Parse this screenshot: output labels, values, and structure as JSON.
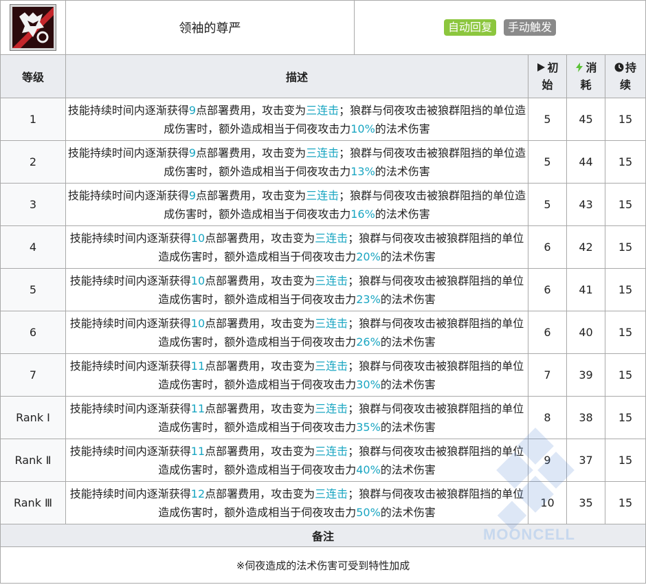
{
  "skill": {
    "name": "领袖的尊严",
    "badges": [
      "自动回复",
      "手动触发"
    ],
    "icon": "wolf-head-skill-icon"
  },
  "columns": {
    "level": "等级",
    "description": "描述",
    "initial_line1": "初",
    "initial_line2": "始",
    "cost_line1": "消",
    "cost_line2": "耗",
    "duration_line1": "持",
    "duration_line2": "续"
  },
  "rows": [
    {
      "level": "1",
      "d1": "技能持续时间内逐渐获得",
      "sp": "9",
      "d2": "点部署费用，攻击变为",
      "hits": "三连击",
      "d3": "；狼群与伺夜攻击被狼群阻挡的单位造成伤害时，额外造成相当于伺夜攻击力",
      "pct": "10%",
      "d4": "的法术伤害",
      "initial": "5",
      "cost": "45",
      "duration": "15"
    },
    {
      "level": "2",
      "d1": "技能持续时间内逐渐获得",
      "sp": "9",
      "d2": "点部署费用，攻击变为",
      "hits": "三连击",
      "d3": "；狼群与伺夜攻击被狼群阻挡的单位造成伤害时，额外造成相当于伺夜攻击力",
      "pct": "13%",
      "d4": "的法术伤害",
      "initial": "5",
      "cost": "44",
      "duration": "15"
    },
    {
      "level": "3",
      "d1": "技能持续时间内逐渐获得",
      "sp": "9",
      "d2": "点部署费用，攻击变为",
      "hits": "三连击",
      "d3": "；狼群与伺夜攻击被狼群阻挡的单位造成伤害时，额外造成相当于伺夜攻击力",
      "pct": "16%",
      "d4": "的法术伤害",
      "initial": "5",
      "cost": "43",
      "duration": "15"
    },
    {
      "level": "4",
      "d1": "技能持续时间内逐渐获得",
      "sp": "10",
      "d2": "点部署费用，攻击变为",
      "hits": "三连击",
      "d3": "；狼群与伺夜攻击被狼群阻挡的单位造成伤害时，额外造成相当于伺夜攻击力",
      "pct": "20%",
      "d4": "的法术伤害",
      "initial": "6",
      "cost": "42",
      "duration": "15"
    },
    {
      "level": "5",
      "d1": "技能持续时间内逐渐获得",
      "sp": "10",
      "d2": "点部署费用，攻击变为",
      "hits": "三连击",
      "d3": "；狼群与伺夜攻击被狼群阻挡的单位造成伤害时，额外造成相当于伺夜攻击力",
      "pct": "23%",
      "d4": "的法术伤害",
      "initial": "6",
      "cost": "41",
      "duration": "15"
    },
    {
      "level": "6",
      "d1": "技能持续时间内逐渐获得",
      "sp": "10",
      "d2": "点部署费用，攻击变为",
      "hits": "三连击",
      "d3": "；狼群与伺夜攻击被狼群阻挡的单位造成伤害时，额外造成相当于伺夜攻击力",
      "pct": "26%",
      "d4": "的法术伤害",
      "initial": "6",
      "cost": "40",
      "duration": "15"
    },
    {
      "level": "7",
      "d1": "技能持续时间内逐渐获得",
      "sp": "11",
      "d2": "点部署费用，攻击变为",
      "hits": "三连击",
      "d3": "；狼群与伺夜攻击被狼群阻挡的单位造成伤害时，额外造成相当于伺夜攻击力",
      "pct": "30%",
      "d4": "的法术伤害",
      "initial": "7",
      "cost": "39",
      "duration": "15"
    },
    {
      "level": "Rank Ⅰ",
      "d1": "技能持续时间内逐渐获得",
      "sp": "11",
      "d2": "点部署费用，攻击变为",
      "hits": "三连击",
      "d3": "；狼群与伺夜攻击被狼群阻挡的单位造成伤害时，额外造成相当于伺夜攻击力",
      "pct": "35%",
      "d4": "的法术伤害",
      "initial": "8",
      "cost": "38",
      "duration": "15"
    },
    {
      "level": "Rank Ⅱ",
      "d1": "技能持续时间内逐渐获得",
      "sp": "11",
      "d2": "点部署费用，攻击变为",
      "hits": "三连击",
      "d3": "；狼群与伺夜攻击被狼群阻挡的单位造成伤害时，额外造成相当于伺夜攻击力",
      "pct": "40%",
      "d4": "的法术伤害",
      "initial": "9",
      "cost": "37",
      "duration": "15"
    },
    {
      "level": "Rank Ⅲ",
      "d1": "技能持续时间内逐渐获得",
      "sp": "12",
      "d2": "点部署费用，攻击变为",
      "hits": "三连击",
      "d3": "；狼群与伺夜攻击被狼群阻挡的单位造成伤害时，额外造成相当于伺夜攻击力",
      "pct": "50%",
      "d4": "的法术伤害",
      "initial": "10",
      "cost": "35",
      "duration": "15"
    }
  ],
  "notes": {
    "header": "备注",
    "text": "※伺夜造成的法术伤害可受到特性加成"
  },
  "watermark": "MOONCELL",
  "colors": {
    "highlight": "#1aa6c2",
    "badge_auto": "#8cc63e",
    "badge_manual": "#8a8a8a",
    "header_bg": "#eaecf0"
  }
}
